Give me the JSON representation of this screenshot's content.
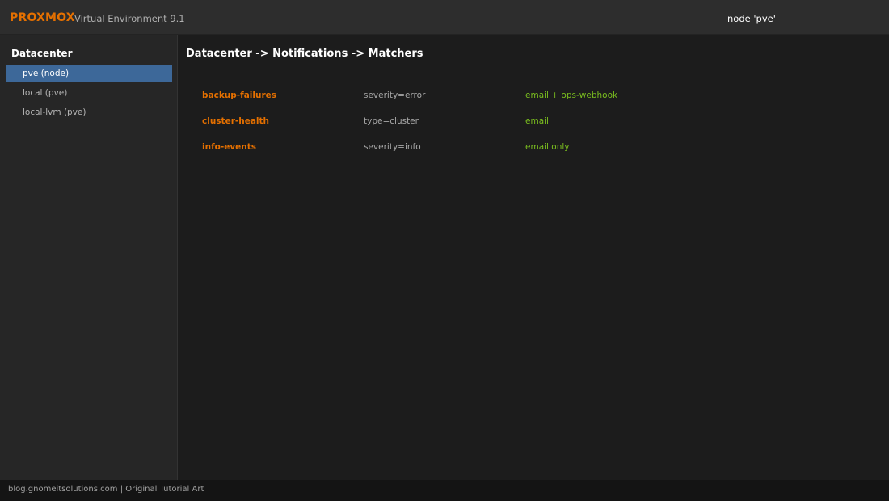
{
  "header": {
    "brand": "PROXMOX",
    "version": "Virtual Environment 9.1",
    "node": "node 'pve'"
  },
  "sidebar": {
    "root": "Datacenter",
    "items": [
      {
        "label": "pve (node)",
        "selected": true
      },
      {
        "label": "local (pve)",
        "selected": false
      },
      {
        "label": "local-lvm (pve)",
        "selected": false
      }
    ]
  },
  "main": {
    "breadcrumb": "Datacenter -> Notifications -> Matchers",
    "matchers": [
      {
        "name": "backup-failures",
        "rule": "severity=error",
        "target": "email + ops-webhook"
      },
      {
        "name": "cluster-health",
        "rule": "type=cluster",
        "target": "email"
      },
      {
        "name": "info-events",
        "rule": "severity=info",
        "target": "email only"
      }
    ]
  },
  "footer": {
    "text": "blog.gnomeitsolutions.com | Original Tutorial Art"
  },
  "colors": {
    "accent": "#e57000",
    "selection": "#3d6899",
    "target_green": "#7bbf1f"
  }
}
